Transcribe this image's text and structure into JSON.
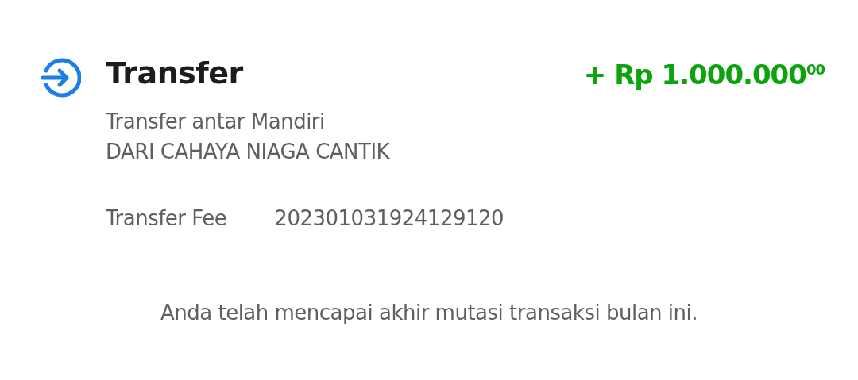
{
  "transaction": {
    "kind": "incoming",
    "title": "Transfer",
    "amount": "+ Rp 1.000.000$^{00}$",
    "description": "Transfer antar Mandiri",
    "counterparty": "DARI CAHAYA NIAGA CANTIK",
    "fee_label": "Transfer Fee",
    "reference": "202301031924129120"
  },
  "footer": "Anda telah mencapai akhir mutasi transaksi bulan ini."
}
